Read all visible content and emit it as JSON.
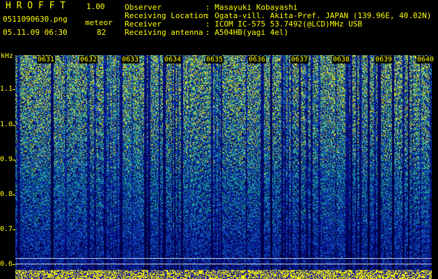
{
  "app": {
    "title": "H R O F F T",
    "version": "1.00",
    "filename": "0511090630.png",
    "mode": "meteor",
    "datetime": "05.11.09 06:30",
    "count": "82"
  },
  "info": {
    "observer_label": "Observer",
    "observer_value": ": Masayuki Kobayashi",
    "location_label": "Receiving Location",
    "location_value": ": Ogata-vill. Akita-Pref. JAPAN (139.96E, 40.02N)",
    "receiver_label": "Receiver",
    "receiver_value": ": ICOM IC-575 53.7492(@LCD)MHz USB",
    "antenna_label": "Receiving antenna",
    "antenna_value": ": A504HB(yagi 4el)"
  },
  "axis": {
    "unit": "kHz",
    "y_ticks": [
      "1.1",
      "1.0",
      "0.9",
      "0.8",
      "0.7",
      "0.6"
    ],
    "x_ticks": [
      "0631",
      "0632",
      "0633",
      "0634",
      "0635",
      "0636",
      "0637",
      "0638",
      "0639",
      "0640"
    ]
  },
  "colors": {
    "label": "#ffff00",
    "background": "#000000"
  }
}
